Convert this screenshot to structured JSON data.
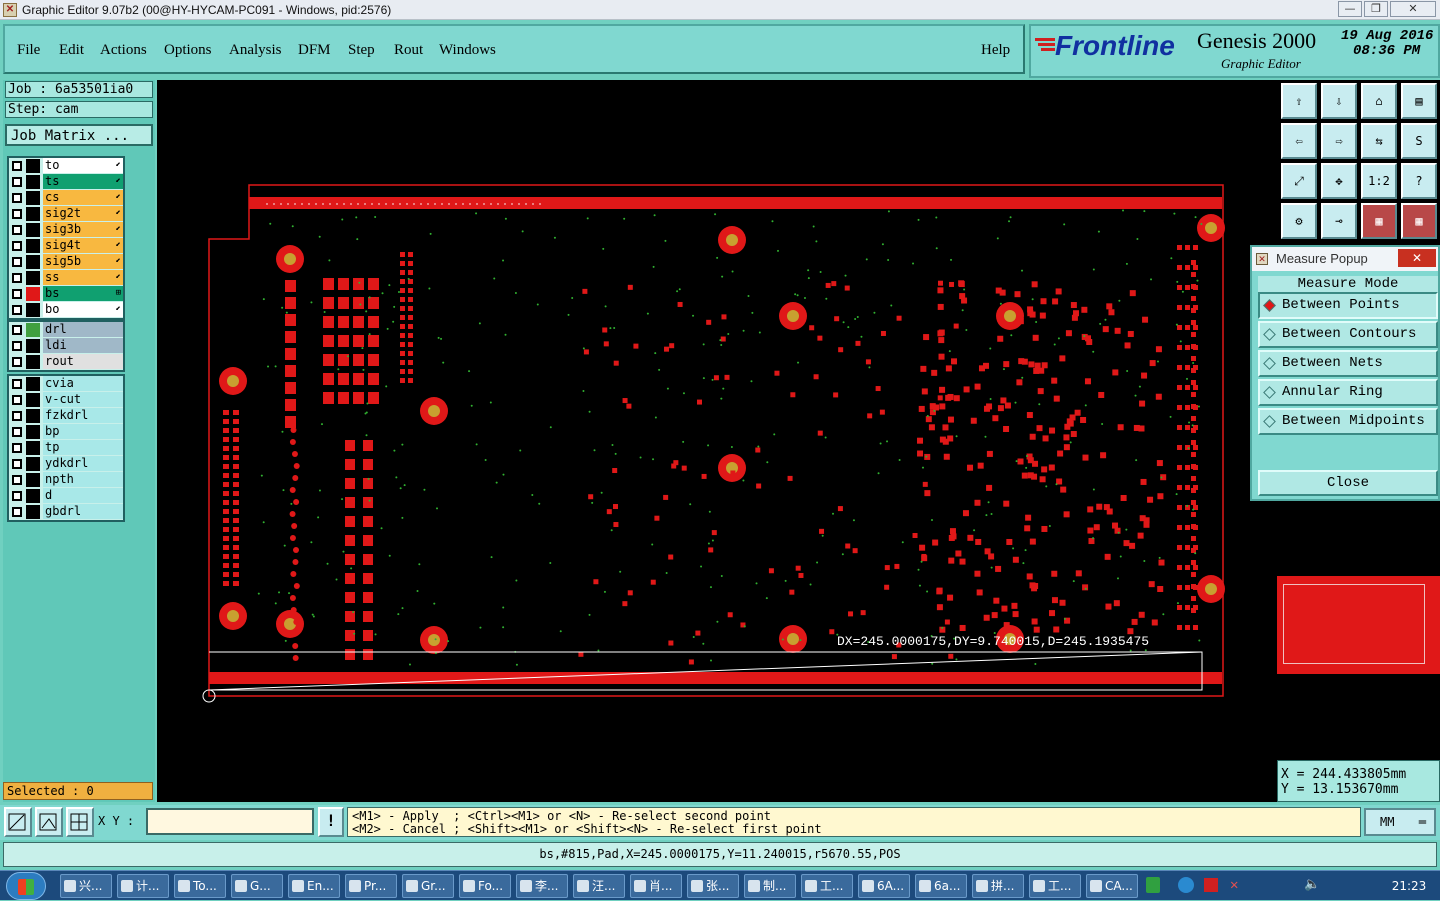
{
  "window": {
    "title": "Graphic Editor 9.07b2 (00@HY-HYCAM-PC091 - Windows, pid:2576)",
    "minimize_label": "—",
    "maximize_label": "❐",
    "close_label": "✕"
  },
  "menu": {
    "file": "File",
    "edit": "Edit",
    "actions": "Actions",
    "options": "Options",
    "analysis": "Analysis",
    "dfm": "DFM",
    "step": "Step",
    "rout": "Rout",
    "windows": "Windows",
    "help": "Help"
  },
  "brand": {
    "logo": "Frontline",
    "product": "Genesis 2000",
    "subtitle": "Graphic Editor",
    "date": "19 Aug 2016",
    "time": "08:36 PM"
  },
  "job": {
    "job_label": "Job : 6a53501ia0",
    "step_label": "Step: cam",
    "matrix_button": "Job Matrix ..."
  },
  "layers": {
    "board": [
      {
        "name": "to",
        "color": "#ffffff",
        "swatch": "#000000",
        "mark": "⬋"
      },
      {
        "name": "ts",
        "color": "#10a070",
        "swatch": "#000000",
        "mark": "⬋"
      },
      {
        "name": "cs",
        "color": "#f8b840",
        "swatch": "#000000",
        "mark": "⬋"
      },
      {
        "name": "sig2t",
        "color": "#f8b840",
        "swatch": "#000000",
        "mark": "⬋"
      },
      {
        "name": "sig3b",
        "color": "#f8b840",
        "swatch": "#000000",
        "mark": "⬋"
      },
      {
        "name": "sig4t",
        "color": "#f8b840",
        "swatch": "#000000",
        "mark": "⬋"
      },
      {
        "name": "sig5b",
        "color": "#f8b840",
        "swatch": "#000000",
        "mark": "⬋"
      },
      {
        "name": "ss",
        "color": "#f8b840",
        "swatch": "#000000",
        "mark": "⬋"
      },
      {
        "name": "bs",
        "color": "#10a070",
        "swatch": "#e01818",
        "mark": "⊞"
      },
      {
        "name": "bo",
        "color": "#ffffff",
        "swatch": "#000000",
        "mark": "⬋"
      }
    ],
    "drill": [
      {
        "name": "drl",
        "color": "#a0b8c8",
        "swatch": "#40a040"
      },
      {
        "name": "ldi",
        "color": "#a0b8c8",
        "swatch": "#000000"
      },
      {
        "name": "rout",
        "color": "#e0e0e0",
        "swatch": "#000000"
      }
    ],
    "misc": [
      {
        "name": "cvia",
        "color": "#a8e8e8",
        "swatch": "#000000"
      },
      {
        "name": "v-cut",
        "color": "#a8e8e8",
        "swatch": "#000000"
      },
      {
        "name": "fzkdrl",
        "color": "#a8e8e8",
        "swatch": "#000000"
      },
      {
        "name": "bp",
        "color": "#a8e8e8",
        "swatch": "#000000"
      },
      {
        "name": "tp",
        "color": "#a8e8e8",
        "swatch": "#000000"
      },
      {
        "name": "ydkdrl",
        "color": "#a8e8e8",
        "swatch": "#000000"
      },
      {
        "name": "npth",
        "color": "#a8e8e8",
        "swatch": "#000000"
      },
      {
        "name": "d",
        "color": "#a8e8e8",
        "swatch": "#000000"
      },
      {
        "name": "gbdrl",
        "color": "#a8e8e8",
        "swatch": "#000000"
      }
    ]
  },
  "selected": "Selected : 0",
  "canvas": {
    "measure_text": "DX=245.0000175,DY=9.740015,D=245.1935475"
  },
  "measure_popup": {
    "title": "Measure Popup",
    "mode_label": "Measure Mode",
    "options": [
      "Between Points",
      "Between Contours",
      "Between Nets",
      "Annular Ring",
      "Between Midpoints"
    ],
    "active_index": 0,
    "close_label": "Close"
  },
  "coords": {
    "x": "X = 244.433805mm",
    "y": "Y = 13.153670mm"
  },
  "bottom": {
    "xy_label": "X Y :",
    "xy_value": "",
    "message_line1": "<M1> - Apply  ; <Ctrl><M1> or <N> - Re-select second point",
    "message_line2": "<M2> - Cancel ; <Shift><M1> or <Shift><N> - Re-select first point",
    "units": "MM",
    "alert_label": "!"
  },
  "status_line": "bs,#815,Pad,X=245.0000175,Y=11.240015,r5670.55,POS",
  "taskbar": {
    "items": [
      "兴...",
      "计...",
      "To...",
      "G...",
      "En...",
      "Pr...",
      "Gr...",
      "Fo...",
      "李...",
      "汪...",
      "肖...",
      "张...",
      "制...",
      "工...",
      "6A...",
      "6a...",
      "拼...",
      "工...",
      "CA..."
    ],
    "clock": "21:23"
  },
  "toolbar_icons": [
    "top-view-icon",
    "bottom-view-icon",
    "home-icon",
    "panel-icon",
    "left-icon",
    "right-icon",
    "mirror-icon",
    "snake-icon",
    "fit-icon",
    "center-icon",
    "ratio-icon",
    "help-icon",
    "tool-icon",
    "key-icon",
    "layer-a-icon",
    "layer-b-icon"
  ],
  "toolbar_glyphs": [
    "⇧",
    "⇩",
    "⌂",
    "▤",
    "⇦",
    "⇨",
    "⇆",
    "S",
    "⤢",
    "✥",
    "1:2",
    "?",
    "⚙",
    "⊸",
    "▦",
    "▦"
  ]
}
